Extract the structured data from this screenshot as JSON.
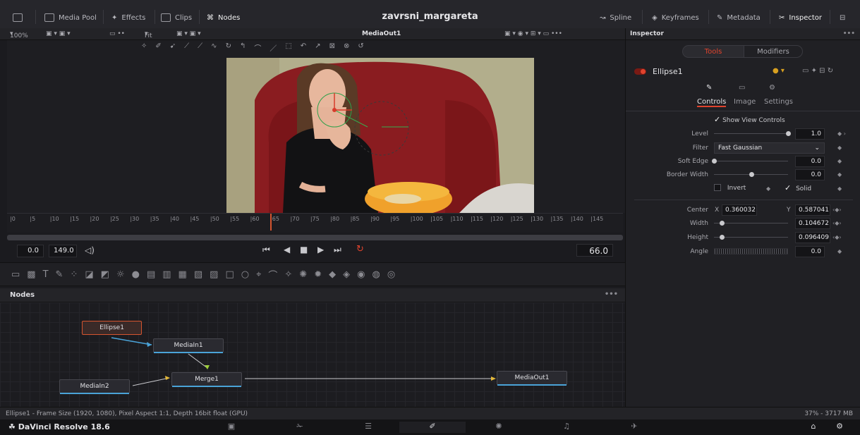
{
  "app": {
    "name": "DaVinci Resolve 18.6",
    "project_title": "zavrsni_margareta"
  },
  "topbar": {
    "media_pool": "Media Pool",
    "effects": "Effects",
    "clips": "Clips",
    "nodes": "Nodes",
    "spline": "Spline",
    "keyframes": "Keyframes",
    "metadata": "Metadata",
    "inspector": "Inspector"
  },
  "viewer": {
    "zoom": "100%",
    "fit": "Fit",
    "title": "MediaOut1"
  },
  "timeline": {
    "ticks": [
      "0",
      "5",
      "10",
      "15",
      "20",
      "25",
      "30",
      "35",
      "40",
      "45",
      "50",
      "55",
      "60",
      "65",
      "70",
      "75",
      "80",
      "85",
      "90",
      "95",
      "100",
      "105",
      "110",
      "115",
      "120",
      "125",
      "130",
      "135",
      "140",
      "145"
    ],
    "start": "0.0",
    "end": "149.0",
    "current": "66.0",
    "playhead_frame": 65
  },
  "nodes": {
    "header": "Nodes",
    "items": {
      "ellipse": "Ellipse1",
      "mediain1": "MediaIn1",
      "mediain2": "MediaIn2",
      "merge": "Merge1",
      "mediaout": "MediaOut1"
    }
  },
  "status": {
    "left": "Ellipse1 - Frame Size (1920, 1080), Pixel Aspect 1:1, Depth 16bit float (GPU)",
    "right": "37% - 3717 MB"
  },
  "inspector": {
    "header": "Inspector",
    "tabs": {
      "tools": "Tools",
      "modifiers": "Modifiers"
    },
    "tool_name": "Ellipse1",
    "subtabs": {
      "controls": "Controls",
      "image": "Image",
      "settings": "Settings"
    },
    "show_view_controls": "Show View Controls",
    "level": {
      "label": "Level",
      "value": "1.0",
      "fraction": 1.0
    },
    "filter": {
      "label": "Filter",
      "value": "Fast Gaussian"
    },
    "soft_edge": {
      "label": "Soft Edge",
      "value": "0.0",
      "fraction": 0.0
    },
    "border_width": {
      "label": "Border Width",
      "value": "0.0",
      "fraction": 0.5
    },
    "invert": "Invert",
    "solid": "Solid",
    "center": {
      "label": "Center",
      "x_label": "X",
      "x": "0.360032",
      "y_label": "Y",
      "y": "0.587041"
    },
    "width": {
      "label": "Width",
      "value": "0.104672",
      "fraction": 0.1
    },
    "height": {
      "label": "Height",
      "value": "0.096409",
      "fraction": 0.1
    },
    "angle": {
      "label": "Angle",
      "value": "0.0"
    }
  },
  "colors": {
    "accent": "#e0432d",
    "link_blue": "#4aa3d8",
    "merge_yellow": "#e3b83a",
    "playhead": "#d5542f"
  }
}
